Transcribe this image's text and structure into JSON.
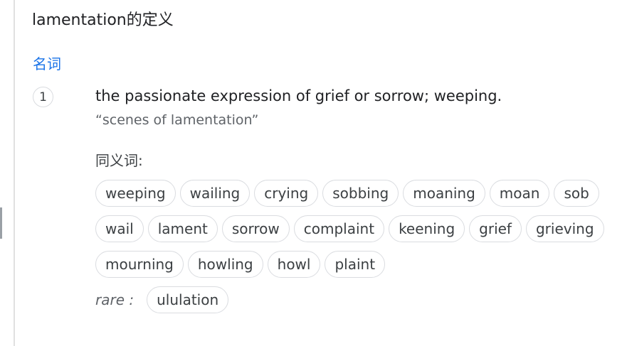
{
  "header": {
    "title": "lamentation的定义"
  },
  "entry": {
    "part_of_speech": "名词",
    "sense_number": "1",
    "definition": "the passionate expression of grief or sorrow; weeping.",
    "example": "“scenes of lamentation”",
    "synonyms_label": "同义词:",
    "synonym_rows": [
      [
        "weeping",
        "wailing",
        "crying",
        "sobbing",
        "moaning",
        "moan",
        "sob"
      ],
      [
        "wail",
        "lament",
        "sorrow",
        "complaint",
        "keening",
        "grief",
        "grieving"
      ],
      [
        "mourning",
        "howling",
        "howl",
        "plaint"
      ]
    ],
    "rare_label": "rare :",
    "rare_synonyms": [
      "ululation"
    ]
  }
}
